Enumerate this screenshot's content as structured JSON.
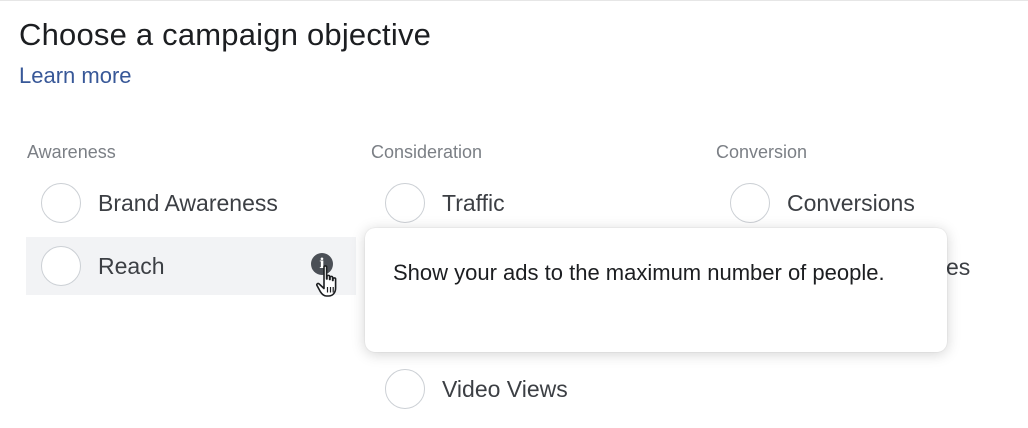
{
  "header": {
    "title": "Choose a campaign objective",
    "learn_more": "Learn more"
  },
  "columns": [
    {
      "heading": "Awareness",
      "options": [
        "Brand Awareness",
        "Reach"
      ]
    },
    {
      "heading": "Consideration",
      "options": [
        "Traffic",
        "Video Views"
      ]
    },
    {
      "heading": "Conversion",
      "options": [
        "Conversions"
      ],
      "partial_text": "es"
    }
  ],
  "tooltip": {
    "text": "Show your ads to the maximum number of people."
  },
  "colors": {
    "link": "#385898",
    "hover_background": "#f2f3f5",
    "radio_border": "#ccd0d5",
    "info_icon": "#4b4f56"
  },
  "icons": {
    "info": "info-icon",
    "cursor": "hand-pointer-cursor-icon"
  }
}
